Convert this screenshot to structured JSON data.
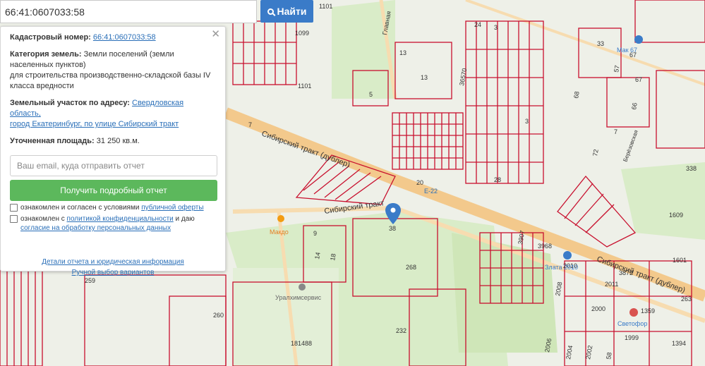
{
  "search": {
    "value": "66:41:0607033:58",
    "button_label": "Найти"
  },
  "panel": {
    "cadastral_label": "Кадастровый номер:",
    "cadastral_value": "66:41:0607033:58",
    "category_label": "Категория земель:",
    "category_line1": "Земли поселений (земли",
    "category_line2": "населенных пунктов)",
    "category_line3": "для строительства производственно-складской базы IV",
    "category_line4": "класса вредности",
    "address_label": "Земельный участок по адресу:",
    "address_line1": "Свердловская область,",
    "address_line2": "город Екатеринбург, по улице Сибирский тракт",
    "area_label": "Уточненная площадь:",
    "area_value": "31 250 кв.м.",
    "email_placeholder": "Ваш email, куда отправить отчет",
    "report_button": "Получить подробный отчет",
    "consent1_text": "ознакомлен и согласен с условиями",
    "consent1_link": "публичной оферты",
    "consent2_text": "ознакомлен с",
    "consent2_link": "политикой конфиденциальности",
    "consent2_mid": "и даю",
    "consent2_link2": "согласие на обработку персональных данных",
    "details_link": "Детали отчета и юридическая информация",
    "manual_link": "Ручной выбор вариантов"
  },
  "map": {
    "labels": [
      "1101",
      "1099",
      "1101",
      "5",
      "13",
      "13",
      "36570",
      "24",
      "3",
      "33",
      "67",
      "57",
      "68",
      "67",
      "66",
      "7",
      "72",
      "338",
      "1609",
      "1601",
      "3",
      "28",
      "20",
      "Е-22",
      "38",
      "268",
      "3907",
      "3968",
      "2010",
      "3872",
      "2011",
      "2008",
      "2000",
      "1359",
      "263",
      "232",
      "260",
      "259",
      "181488",
      "2006",
      "2004",
      "2002",
      "58",
      "1999",
      "1394",
      "9",
      "14",
      "18",
      "7"
    ],
    "road_labels": [
      "Сибирский тракт (дублер)",
      "Сибирский тракт",
      "Сибирский тракт (дублер)",
      "Главная",
      "Берёзовская"
    ],
    "poi": [
      "Мак 67",
      "Макдо",
      "Уралхимсервис",
      "Злата 2010",
      "Светофор"
    ]
  },
  "colors": {
    "parcel": "#c8102e",
    "road": "#f3c98c",
    "green": "#cfe6b8",
    "accent": "#3a7bc8",
    "button_green": "#5cb85c"
  }
}
